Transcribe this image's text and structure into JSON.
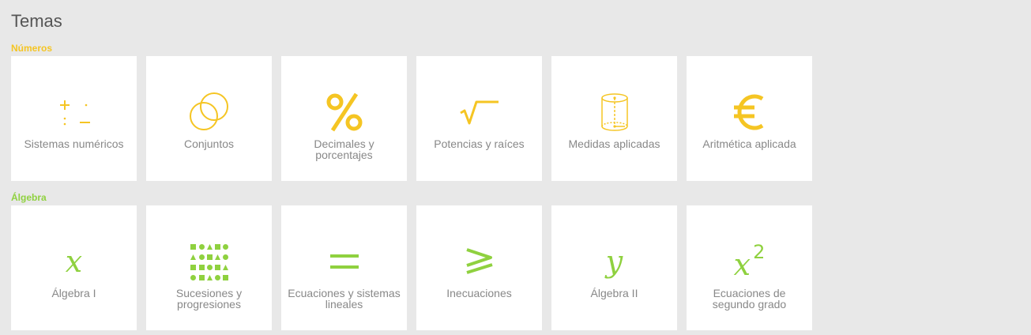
{
  "page": {
    "title": "Temas"
  },
  "colors": {
    "numeros": "#f5c523",
    "algebra": "#8fd13f"
  },
  "sections": [
    {
      "label": "Números",
      "color": "#f5c523",
      "cards": [
        {
          "label": "Sistemas numéricos",
          "icon": "plus-minus-times-divide-icon"
        },
        {
          "label": "Conjuntos",
          "icon": "venn-circles-icon"
        },
        {
          "label": "Decimales y porcentajes",
          "icon": "percent-icon"
        },
        {
          "label": "Potencias y raíces",
          "icon": "square-root-icon"
        },
        {
          "label": "Medidas aplicadas",
          "icon": "cylinder-icon"
        },
        {
          "label": "Aritmética aplicada",
          "icon": "euro-icon"
        }
      ]
    },
    {
      "label": "Álgebra",
      "color": "#8fd13f",
      "cards": [
        {
          "label": "Álgebra I",
          "icon": "variable-x-icon",
          "glyph": "x"
        },
        {
          "label": "Sucesiones y progresiones",
          "icon": "shape-sequence-icon"
        },
        {
          "label": "Ecuaciones y sistemas lineales",
          "icon": "equals-icon",
          "glyph": "="
        },
        {
          "label": "Inecuaciones",
          "icon": "greater-equal-icon",
          "glyph": "⩾"
        },
        {
          "label": "Álgebra II",
          "icon": "variable-y-icon",
          "glyph": "y"
        },
        {
          "label": "Ecuaciones de segundo grado",
          "icon": "x-squared-icon",
          "glyph": "x",
          "superscript": "2"
        }
      ]
    }
  ]
}
